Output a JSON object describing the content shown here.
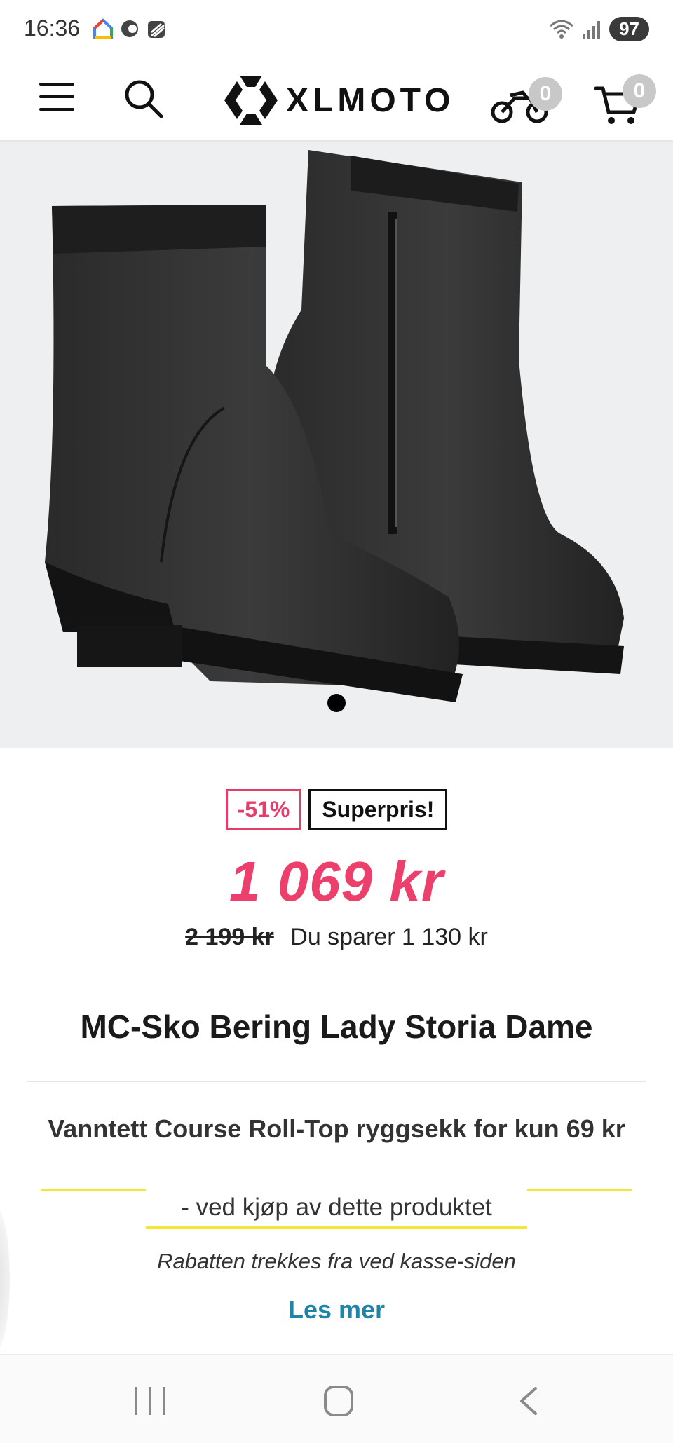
{
  "status_bar": {
    "time": "16:36",
    "battery": "97",
    "icons": [
      "google-home-icon",
      "sync-icon",
      "stack-icon",
      "wifi-icon",
      "signal-icon"
    ]
  },
  "header": {
    "logo_text": "XLMOTO",
    "garage_count": "0",
    "cart_count": "0",
    "icons": [
      "menu-icon",
      "search-icon",
      "motorcycle-icon",
      "cart-icon"
    ]
  },
  "gallery": {
    "slide_count": 1,
    "active_slide": 1
  },
  "product": {
    "discount_badge": "-51%",
    "promo_badge": "Superpris!",
    "price": "1 069 kr",
    "old_price": "2 199 kr",
    "savings_text": "Du sparer 1 130 kr",
    "title": "MC-Sko Bering Lady Storia Dame"
  },
  "promo": {
    "title": "Vanntett Course Roll-Top ryggsekk for kun 69 kr",
    "subtitle": "- ved kjøp av dette produktet",
    "note": "Rabatten trekkes fra ved kasse-siden",
    "read_more": "Les mer"
  },
  "colors": {
    "price": "#ec3f6c",
    "link": "#1e84a8",
    "highlight": "#f2e636",
    "image_bg": "#eeeff0"
  },
  "nav_bar": {
    "icons": [
      "recent-apps-icon",
      "home-icon",
      "back-icon"
    ]
  }
}
